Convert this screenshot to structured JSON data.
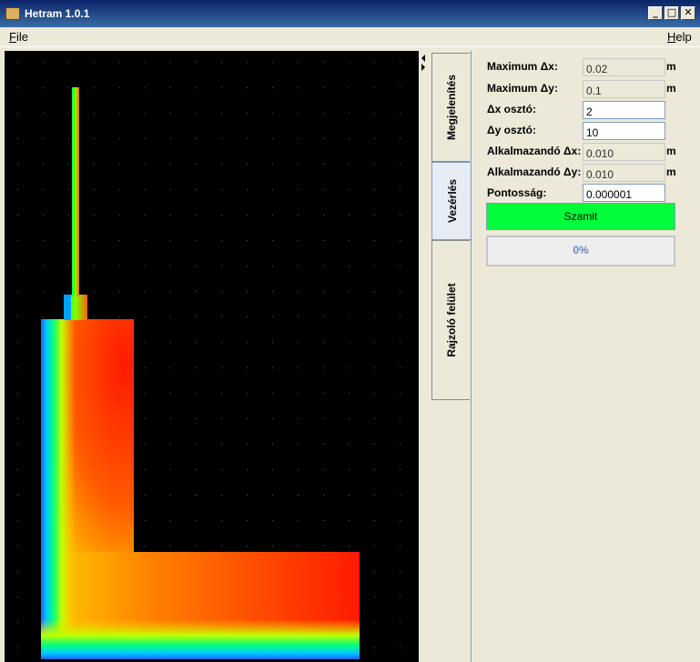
{
  "window": {
    "title": "Hetram 1.0.1",
    "minimize_label": "_",
    "maximize_label": "□",
    "close_label": "✕"
  },
  "menu": {
    "file_mnemonic": "F",
    "file_rest": "ile",
    "help_mnemonic": "H",
    "help_rest": "elp"
  },
  "tabs": [
    {
      "label": "Megjelenítés",
      "active": false
    },
    {
      "label": "Vezérlés",
      "active": true
    },
    {
      "label": "Rajzoló felület",
      "active": false
    }
  ],
  "controls": {
    "max_dx_label": "Maximum Δx:",
    "max_dx_value": "0.02",
    "max_dy_label": "Maximum Δy:",
    "max_dy_value": "0.1",
    "dx_div_label": "Δx osztó:",
    "dx_div_value": "2",
    "dy_div_label": "Δy osztó:",
    "dy_div_value": "10",
    "app_dx_label": "Alkalmazandó Δx:",
    "app_dx_value": "0.010",
    "app_dy_label": "Alkalmazandó Δy:",
    "app_dy_value": "0.010",
    "precision_label": "Pontosság:",
    "precision_value": "0.000001",
    "unit": "m",
    "calculate_label": "Szamit",
    "progress_label": "0%",
    "progress_value": 0
  },
  "colors": {
    "calc_button": "#00ff3a",
    "progress_text": "#6b86c4",
    "canvas_bg": "#000000",
    "grid_dot": "#4a4a4a",
    "heat_hot": "#ff2000",
    "heat_cold": "#0040ff"
  }
}
